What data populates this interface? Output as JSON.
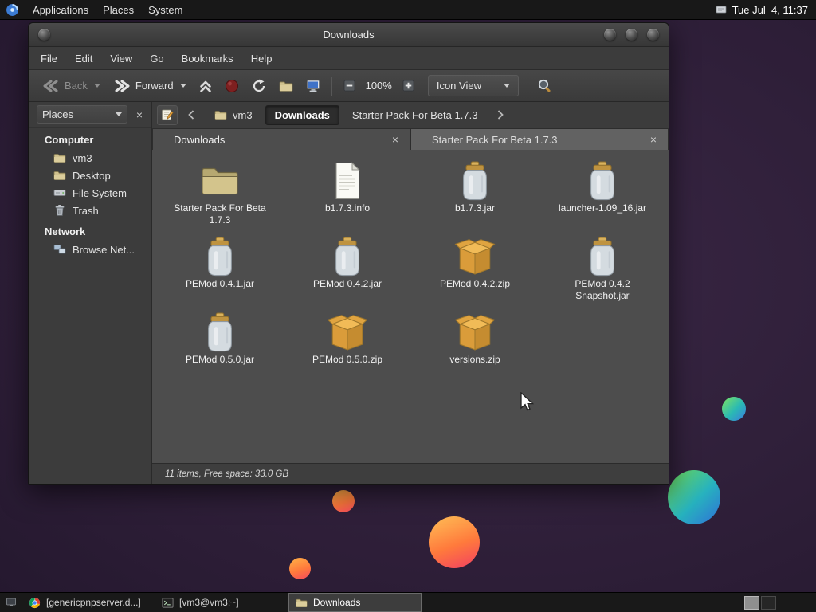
{
  "colors": {
    "desktop": "#2c1d36",
    "panel": "#181818",
    "window_chrome": "#3e3e3e",
    "content_bg": "#4d4d4d",
    "folder_accent": "#d3c48c",
    "archive_accent": "#e0a440"
  },
  "top_panel": {
    "menus": [
      "Applications",
      "Places",
      "System"
    ],
    "clock": "Tue Jul  4, 11:37"
  },
  "window": {
    "title": "Downloads",
    "menubar": [
      "File",
      "Edit",
      "View",
      "Go",
      "Bookmarks",
      "Help"
    ],
    "toolbar": {
      "back": "Back",
      "forward": "Forward",
      "zoom_level": "100%",
      "view_mode": "Icon View"
    },
    "breadcrumbs": [
      {
        "label": "vm3",
        "icon": "folder",
        "active": false
      },
      {
        "label": "Downloads",
        "icon": "",
        "active": true
      },
      {
        "label": "Starter Pack For Beta 1.7.3",
        "icon": "",
        "active": false
      }
    ],
    "sidebar": {
      "header": "Places",
      "groups": [
        {
          "label": "Computer",
          "items": [
            {
              "label": "vm3",
              "icon": "folder"
            },
            {
              "label": "Desktop",
              "icon": "folder"
            },
            {
              "label": "File System",
              "icon": "drive"
            },
            {
              "label": "Trash",
              "icon": "trash"
            }
          ]
        },
        {
          "label": "Network",
          "items": [
            {
              "label": "Browse Net...",
              "icon": "network"
            }
          ]
        }
      ]
    },
    "tabs": [
      {
        "label": "Downloads",
        "active": true
      },
      {
        "label": "Starter Pack For Beta 1.7.3",
        "active": false
      }
    ],
    "files": [
      {
        "name": "Starter Pack For Beta 1.7.3",
        "type": "folder"
      },
      {
        "name": "b1.7.3.info",
        "type": "text"
      },
      {
        "name": "b1.7.3.jar",
        "type": "jar"
      },
      {
        "name": "launcher-1.09_16.jar",
        "type": "jar"
      },
      {
        "name": "PEMod 0.4.1.jar",
        "type": "jar"
      },
      {
        "name": "PEMod 0.4.2.jar",
        "type": "jar"
      },
      {
        "name": "PEMod 0.4.2.zip",
        "type": "zip"
      },
      {
        "name": "PEMod 0.4.2 Snapshot.jar",
        "type": "jar"
      },
      {
        "name": "PEMod 0.5.0.jar",
        "type": "jar"
      },
      {
        "name": "PEMod 0.5.0.zip",
        "type": "zip"
      },
      {
        "name": "versions.zip",
        "type": "zip"
      }
    ],
    "statusbar": "11 items, Free space: 33.0 GB"
  },
  "taskbar": {
    "windows": [
      {
        "label": "[genericpnpserver.d...]",
        "icon": "browser",
        "active": false
      },
      {
        "label": "[vm3@vm3:~]",
        "icon": "terminal",
        "active": false
      },
      {
        "label": "Downloads",
        "icon": "folder",
        "active": true
      }
    ],
    "workspaces": 2,
    "active_workspace": 1
  }
}
